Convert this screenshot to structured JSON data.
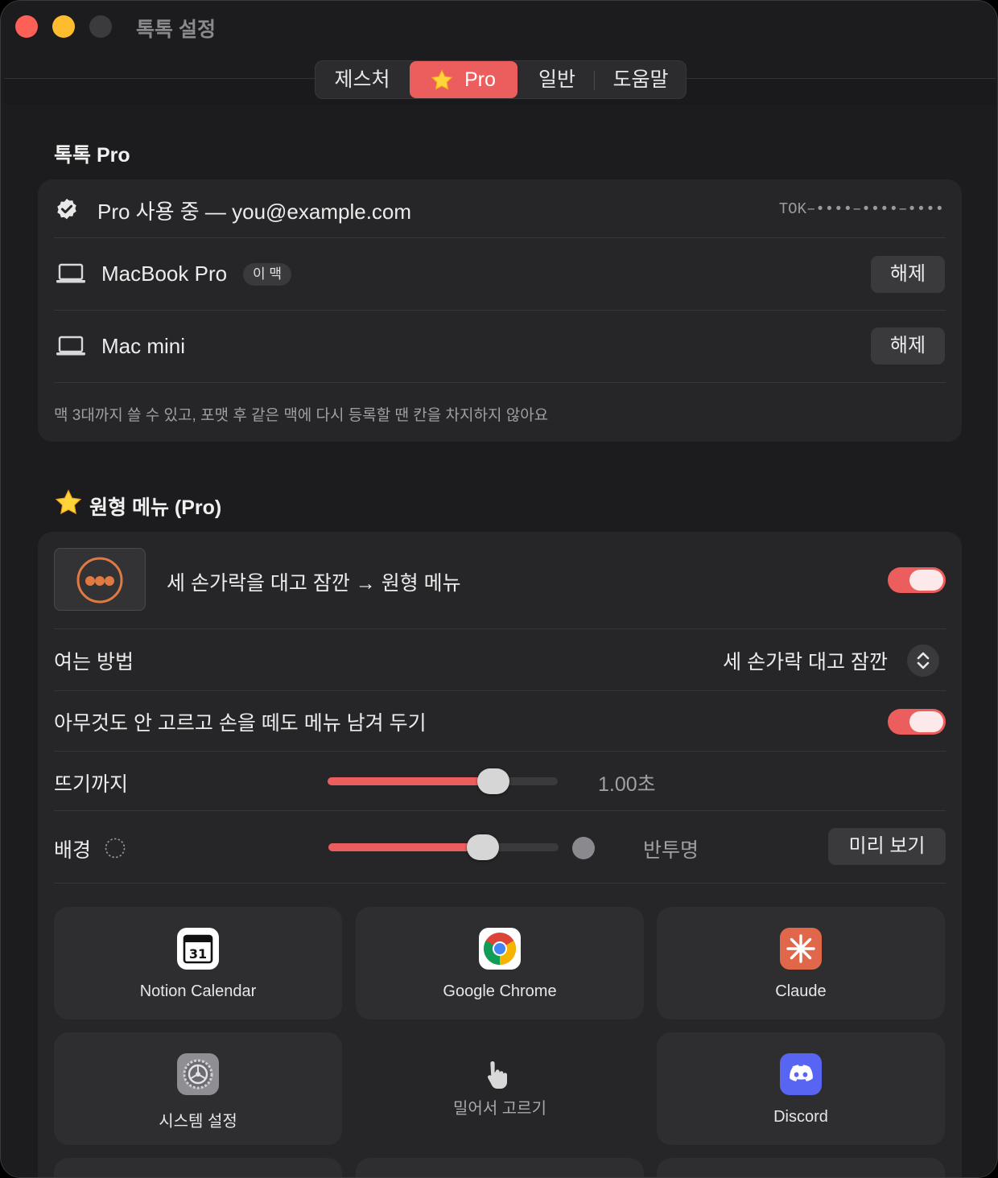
{
  "window": {
    "title": "톡톡 설정"
  },
  "tabs": [
    {
      "label": "제스처"
    },
    {
      "label": "Pro",
      "icon": "star-icon"
    },
    {
      "label": "일반"
    },
    {
      "label": "도움말"
    }
  ],
  "pro_section": {
    "title": "톡톡 Pro",
    "status": "Pro 사용 중 — you@example.com",
    "license_key": "TOK–••••–••••–••••",
    "devices": [
      {
        "name": "MacBook Pro",
        "badge": "이 맥",
        "action": "해제"
      },
      {
        "name": "Mac mini",
        "badge": "",
        "action": "해제"
      }
    ],
    "note": "맥 3대까지 쓸 수 있고, 포맷 후 같은 맥에 다시 등록할 땐 칸을 차지하지 않아요"
  },
  "radial_section": {
    "title": "원형 메뉴 (Pro)",
    "enable_label": "세 손가락을 대고 잠깐 → 원형 메뉴",
    "enable_on": true,
    "open_method_label": "여는 방법",
    "open_method_value": "세 손가락 대고 잠깐",
    "keep_menu_label": "아무것도 안 고르고 손을 떼도 메뉴 남겨 두기",
    "keep_menu_on": true,
    "delay_label": "뜨기까지",
    "delay_value": "1.00초",
    "delay_fraction": 0.72,
    "background_label": "배경",
    "background_value": "반투명",
    "background_fraction": 0.67,
    "preview_label": "미리 보기",
    "apps": [
      {
        "name": "Notion Calendar",
        "icon": "notion-calendar-icon"
      },
      {
        "name": "Google Chrome",
        "icon": "chrome-icon"
      },
      {
        "name": "Claude",
        "icon": "claude-icon"
      },
      {
        "name": "시스템 설정",
        "icon": "system-settings-icon"
      },
      {
        "name": "밀어서 고르기",
        "icon": "hand-pointer-icon"
      },
      {
        "name": "Discord",
        "icon": "discord-icon"
      }
    ]
  },
  "colors": {
    "accent": "#ec5d5d",
    "background": "#1c1c1e",
    "card": "#262628"
  }
}
